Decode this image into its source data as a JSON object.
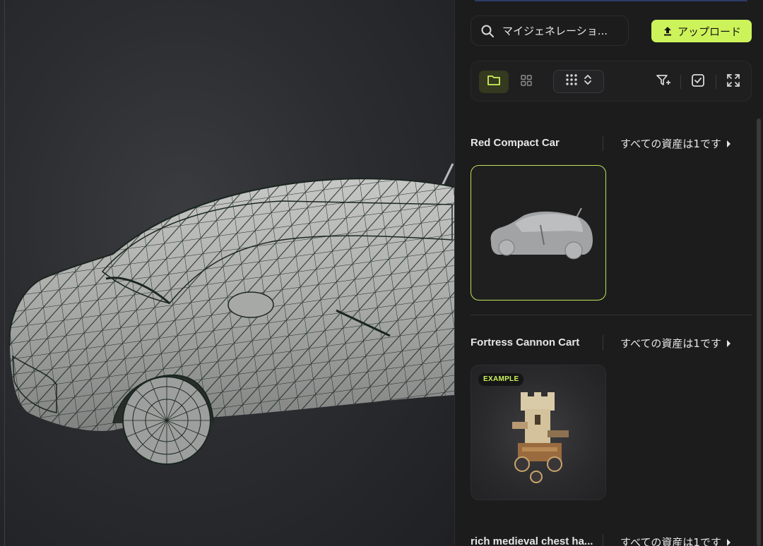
{
  "search": {
    "value": "マイジェネレーショ..."
  },
  "upload": {
    "label": "アップロード"
  },
  "toolbar": {
    "view_folder": "folder-icon",
    "view_grid": "grid-icon",
    "density": "dots-grid-icon",
    "filter": "filter-icon",
    "select": "checkbox-icon",
    "expand": "expand-icon"
  },
  "sections": [
    {
      "title": "Red Compact Car",
      "link": "すべての資産は1です"
    },
    {
      "title": "Fortress Cannon Cart",
      "link": "すべての資産は1です",
      "badge": "EXAMPLE"
    },
    {
      "title": "rich medieval chest ha...",
      "link": "すべての資産は1です"
    }
  ],
  "colors": {
    "accent": "#cdf35a",
    "panel_bg": "#1c1c1d",
    "viewport_bg": "#2b2d31"
  }
}
